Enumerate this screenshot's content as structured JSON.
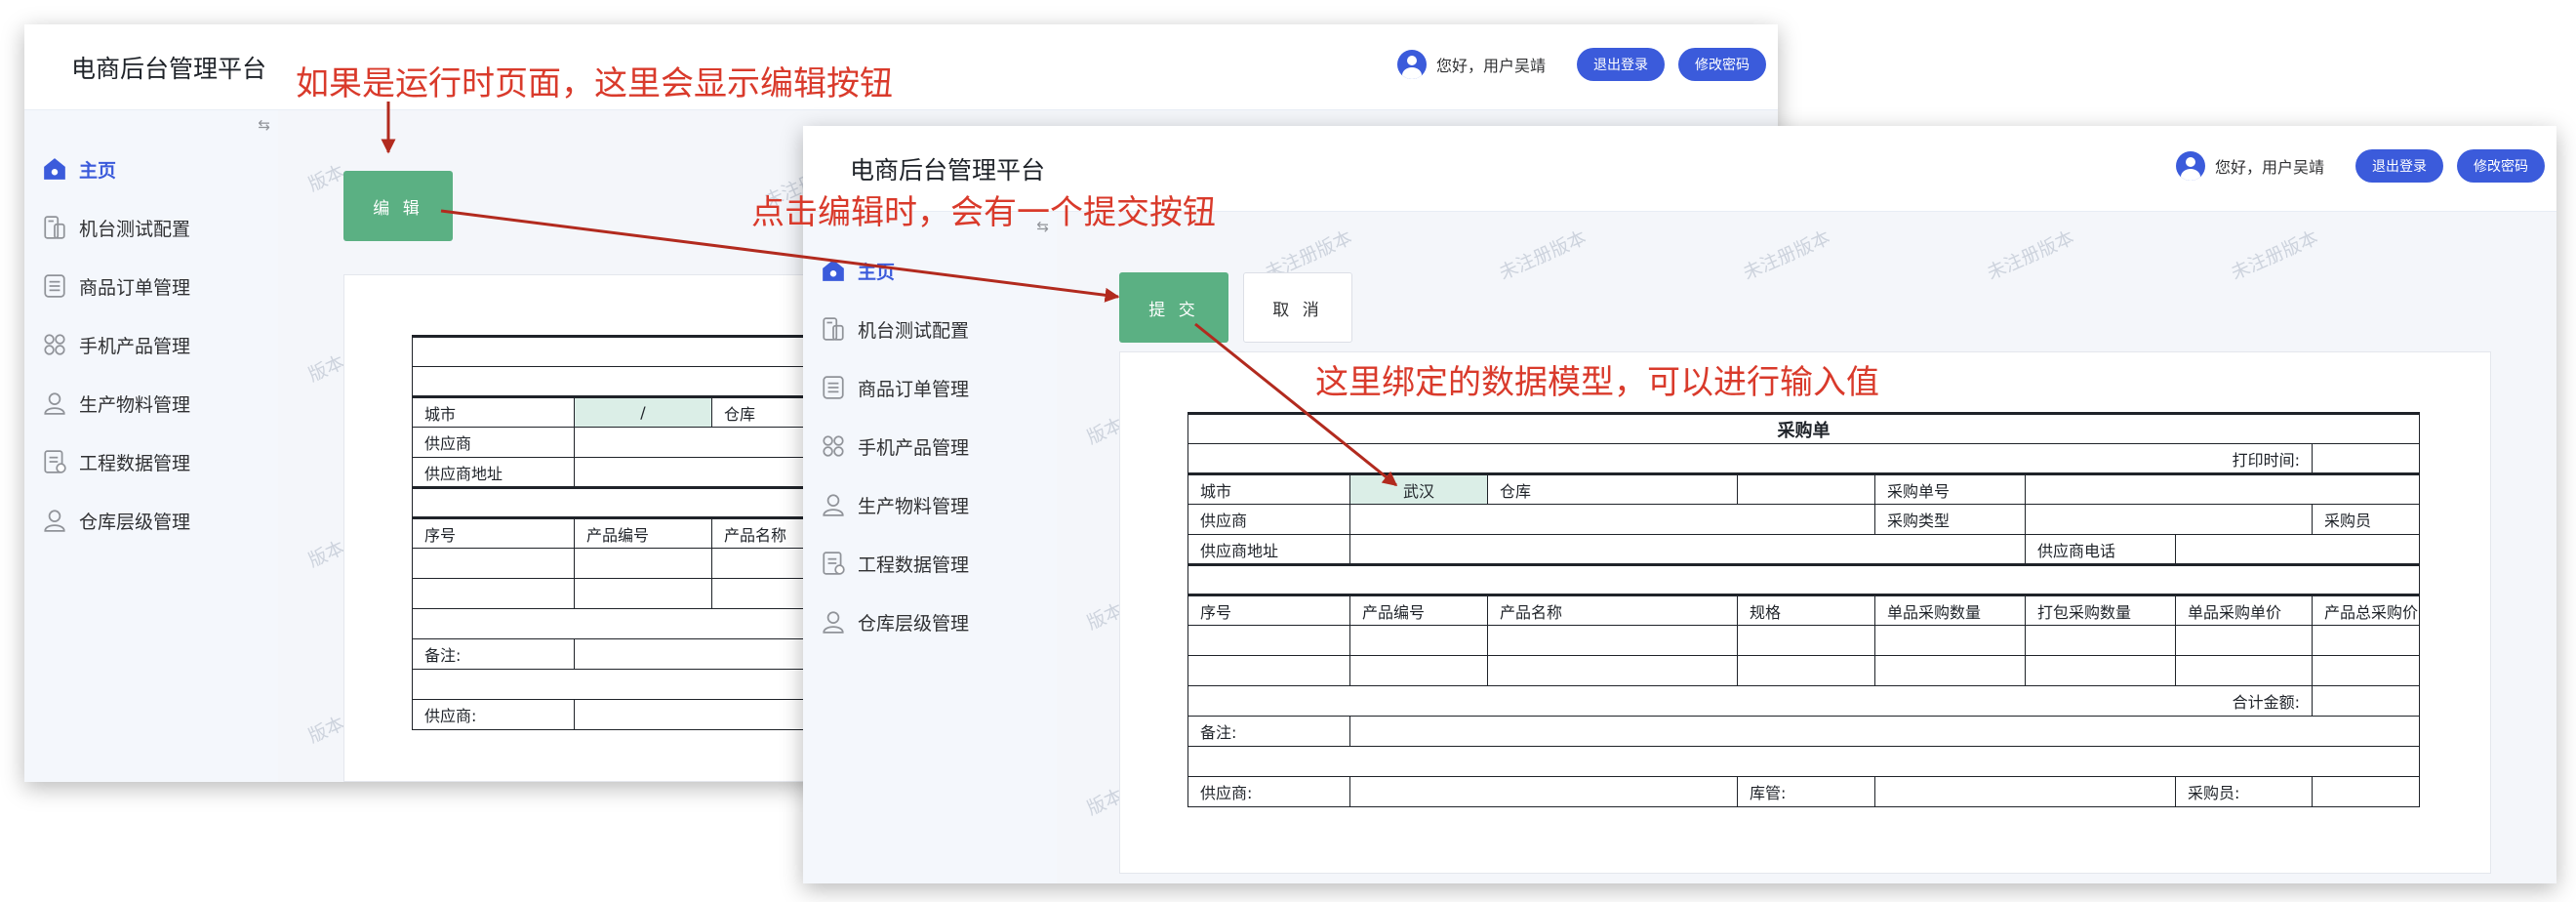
{
  "app": {
    "title": "电商后台管理平台",
    "greeting": "您好，用户吴靖",
    "logout_label": "退出登录",
    "change_password_label": "修改密码",
    "collapse_icon": "⇆"
  },
  "nav": [
    {
      "label": "主页",
      "icon": "home-icon"
    },
    {
      "label": "机台测试配置",
      "icon": "device-icon"
    },
    {
      "label": "商品订单管理",
      "icon": "order-list-icon"
    },
    {
      "label": "手机产品管理",
      "icon": "product-grid-icon"
    },
    {
      "label": "生产物料管理",
      "icon": "person-icon"
    },
    {
      "label": "工程数据管理",
      "icon": "document-icon"
    },
    {
      "label": "仓库层级管理",
      "icon": "person-icon"
    }
  ],
  "watermark": {
    "short": "版本",
    "long": "未注册版本"
  },
  "left_window": {
    "edit_button": "编 辑",
    "form": {
      "city_label": "城市",
      "city_value": "/",
      "warehouse_label": "仓库",
      "supplier_label": "供应商",
      "supplier_address_label": "供应商地址",
      "col_no": "序号",
      "col_product_code": "产品编号",
      "col_product_name": "产品名称",
      "remarks_label": "备注:",
      "supplier_sign_label": "供应商:"
    }
  },
  "right_window": {
    "submit_button": "提 交",
    "cancel_button": "取 消",
    "form": {
      "title": "采购单",
      "print_time_label": "打印时间:",
      "city_label": "城市",
      "city_value": "武汉",
      "warehouse_label": "仓库",
      "po_number_label": "采购单号",
      "supplier_label": "供应商",
      "po_type_label": "采购类型",
      "buyer_label": "采购员",
      "supplier_address_label": "供应商地址",
      "supplier_phone_label": "供应商电话",
      "columns": [
        "序号",
        "产品编号",
        "产品名称",
        "规格",
        "单品采购数量",
        "打包采购数量",
        "单品采购单价",
        "产品总采购价"
      ],
      "total_label": "合计金额:",
      "remarks_label": "备注:",
      "supplier_sign_label": "供应商:",
      "warehouse_keeper_label": "库管:",
      "buyer_sign_label": "采购员:"
    }
  },
  "annotations": {
    "runtime_note": "如果是运行时页面，这里会显示编辑按钮",
    "submit_note": "点击编辑时，会有一个提交按钮",
    "binding_note": "这里绑定的数据模型，可以进行输入值"
  },
  "colors": {
    "brand_blue": "#3b5bdb",
    "button_green": "#5bb083",
    "highlight_cell": "#dbeee7",
    "annotation_red": "#d93a2b",
    "arrow_red": "#b22a1e"
  }
}
